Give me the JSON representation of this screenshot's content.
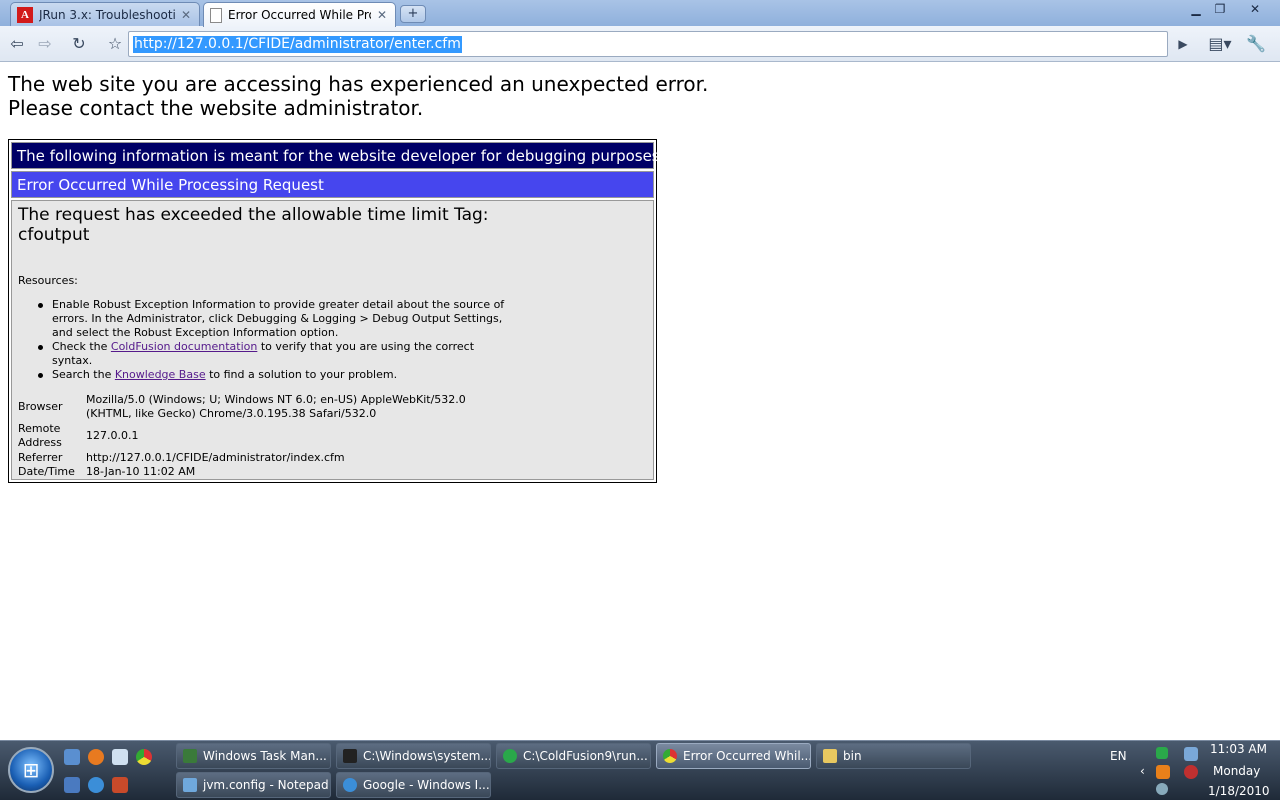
{
  "browser": {
    "tabs": [
      {
        "label": "JRun 3.x: Troubleshootin...",
        "icon": "adobe-icon",
        "active": false
      },
      {
        "label": "Error Occurred While Pro...",
        "icon": "page-icon",
        "active": true
      }
    ],
    "new_tab_symbol": "+",
    "url": "http://127.0.0.1/CFIDE/administrator/enter.cfm",
    "adobe_icon_letter": "A"
  },
  "page": {
    "headline_line1": "The web site you are accessing has experienced an unexpected error.",
    "headline_line2": "Please contact the website administrator.",
    "debug_banner": "The following information is meant for the website developer for debugging purposes.",
    "error_title": "Error Occurred While Processing Request",
    "error_message_line1": "The request has exceeded the allowable time limit Tag:",
    "error_message_line2": "cfoutput",
    "resources_label": "Resources:",
    "resources": {
      "item1": "Enable Robust Exception Information to provide greater detail about the source of errors. In the Administrator, click Debugging & Logging > Debug Output Settings, and select the Robust Exception Information option.",
      "item2_before": "Check the ",
      "item2_link": "ColdFusion documentation",
      "item2_after": " to verify that you are using the correct syntax.",
      "item3_before": "Search the ",
      "item3_link": "Knowledge Base",
      "item3_after": " to find a solution to your problem."
    },
    "info": {
      "browser_key": "Browser",
      "browser_value_line1": "Mozilla/5.0 (Windows; U; Windows NT 6.0; en-US) AppleWebKit/532.0",
      "browser_value_line2": "(KHTML, like Gecko) Chrome/3.0.195.38 Safari/532.0",
      "remote_key_line1": "Remote",
      "remote_key_line2": "Address",
      "remote_value": "127.0.0.1",
      "referrer_key": "Referrer",
      "referrer_value": "http://127.0.0.1/CFIDE/administrator/index.cfm",
      "datetime_key": "Date/Time",
      "datetime_value": "18-Jan-10 11:02 AM"
    }
  },
  "taskbar": {
    "buttons": [
      {
        "label": "Windows Task Man...",
        "icon": "task-manager-icon",
        "color": "#3a7a3a"
      },
      {
        "label": "C:\\Windows\\system...",
        "icon": "cmd-icon",
        "color": "#222222"
      },
      {
        "label": "C:\\ColdFusion9\\run...",
        "icon": "coldfusion-icon",
        "color": "#2aa84a"
      },
      {
        "label": "Error Occurred Whil...",
        "icon": "chrome-icon",
        "color": "#e0a020"
      },
      {
        "label": "bin",
        "icon": "folder-icon",
        "color": "#e8c860"
      },
      {
        "label": "jvm.config - Notepad",
        "icon": "notepad-icon",
        "color": "#6fa8dc"
      },
      {
        "label": "Google - Windows I...",
        "icon": "ie-icon",
        "color": "#3b8ed8"
      }
    ],
    "language": "EN",
    "time": "11:03 AM",
    "day": "Monday",
    "date": "1/18/2010"
  },
  "colors": {
    "debug_banner_bg": "#000066",
    "error_title_bg": "#4646ee",
    "body_bg": "#e7e7e7",
    "link": "#551a8b",
    "url_highlight": "#3399ff"
  }
}
